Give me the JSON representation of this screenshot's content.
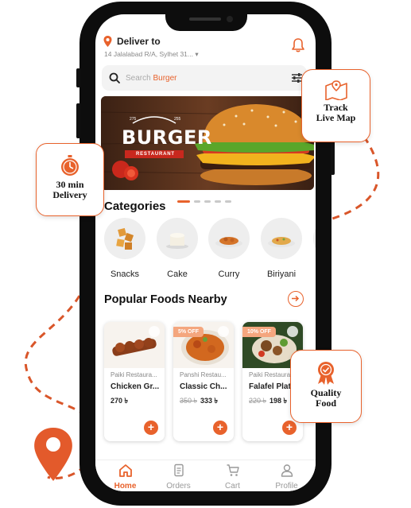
{
  "header": {
    "deliver_label": "Deliver to",
    "address": "14 Jalalabad R/A, Sylhet 31...",
    "search_prefix": "Search ",
    "search_highlight": "Burger"
  },
  "banner": {
    "numbers_left": "275",
    "numbers_right": "255",
    "brand_title": "BURGER",
    "brand_subtitle": "RESTAURANT"
  },
  "categories": {
    "title": "Categories",
    "items": [
      {
        "label": "Snacks"
      },
      {
        "label": "Cake"
      },
      {
        "label": "Curry"
      },
      {
        "label": "Biriyani"
      }
    ]
  },
  "popular": {
    "title": "Popular Foods Nearby",
    "items": [
      {
        "restaurant": "Paiki Restaura...",
        "name": "Chicken Gr...",
        "old_price": "",
        "price": "270 ৳",
        "badge": ""
      },
      {
        "restaurant": "Panshi Restau...",
        "name": "Classic Ch...",
        "old_price": "350 ৳",
        "price": "333 ৳",
        "badge": "5% OFF"
      },
      {
        "restaurant": "Paiki Restaura...",
        "name": "Falafel Plat",
        "old_price": "220 ৳",
        "price": "198 ৳",
        "badge": "10% OFF"
      }
    ]
  },
  "nav": {
    "items": [
      {
        "label": "Home",
        "icon": "home-icon",
        "active": true
      },
      {
        "label": "Orders",
        "icon": "orders-icon"
      },
      {
        "label": "Cart",
        "icon": "cart-icon"
      },
      {
        "label": "Profile",
        "icon": "profile-icon"
      }
    ]
  },
  "callouts": {
    "delivery_line1": "30 min",
    "delivery_line2": "Delivery",
    "map_line1": "Track",
    "map_line2": "Live Map",
    "quality_line1": "Quality",
    "quality_line2": "Food"
  },
  "colors": {
    "accent": "#e8622c",
    "phone": "#0d0d0d"
  }
}
